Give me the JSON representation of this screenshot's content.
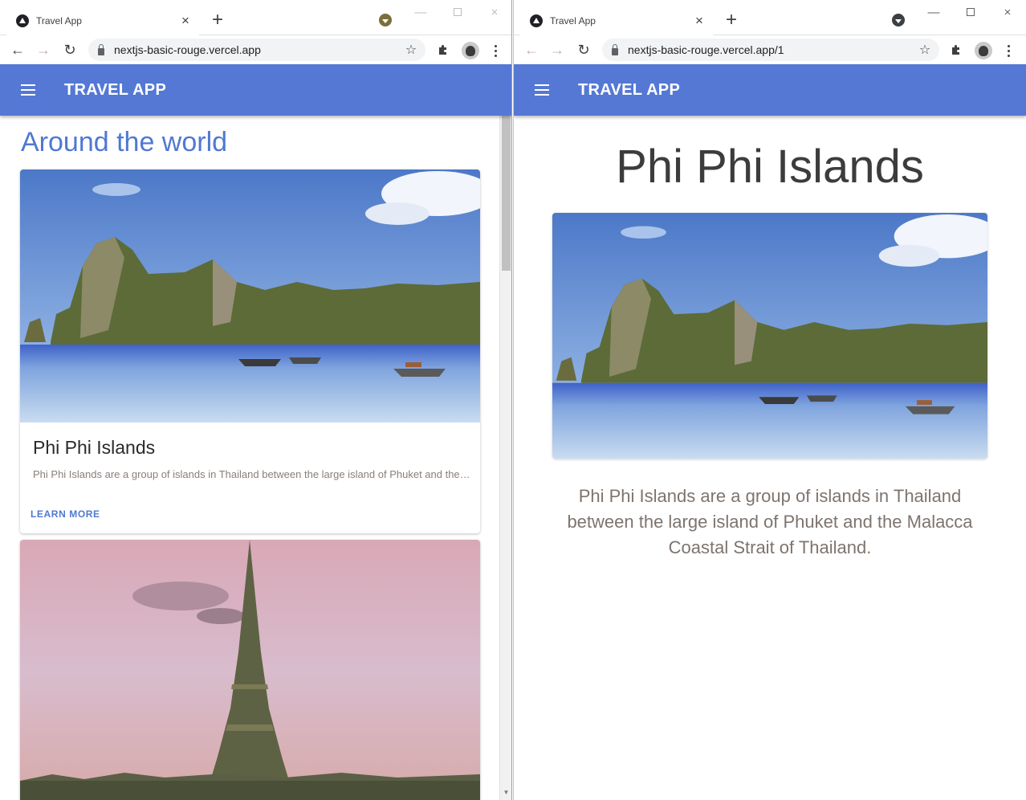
{
  "windows": [
    {
      "tab_title": "Travel App",
      "url": "nextjs-basic-rouge.vercel.app",
      "app_title": "TRAVEL APP",
      "section_heading": "Around the world",
      "cards": [
        {
          "title": "Phi Phi Islands",
          "description": "Phi Phi Islands are a group of islands in Thailand between the large island of Phuket and the Malacca Coastal Strait of Thailand.",
          "action": "LEARN MORE"
        }
      ]
    },
    {
      "tab_title": "Travel App",
      "url": "nextjs-basic-rouge.vercel.app/1",
      "app_title": "TRAVEL APP",
      "detail_title": "Phi Phi Islands",
      "detail_description": "Phi Phi Islands are a group of islands in Thailand between the large island of Phuket and the Malacca Coastal Strait of Thailand."
    }
  ],
  "icons": {
    "close": "×",
    "new_tab": "+",
    "back": "←",
    "forward": "→",
    "reload": "↻",
    "star": "☆",
    "minimize": "—"
  },
  "colors": {
    "app_bar": "#5478d4",
    "accent": "#4f78d2"
  }
}
